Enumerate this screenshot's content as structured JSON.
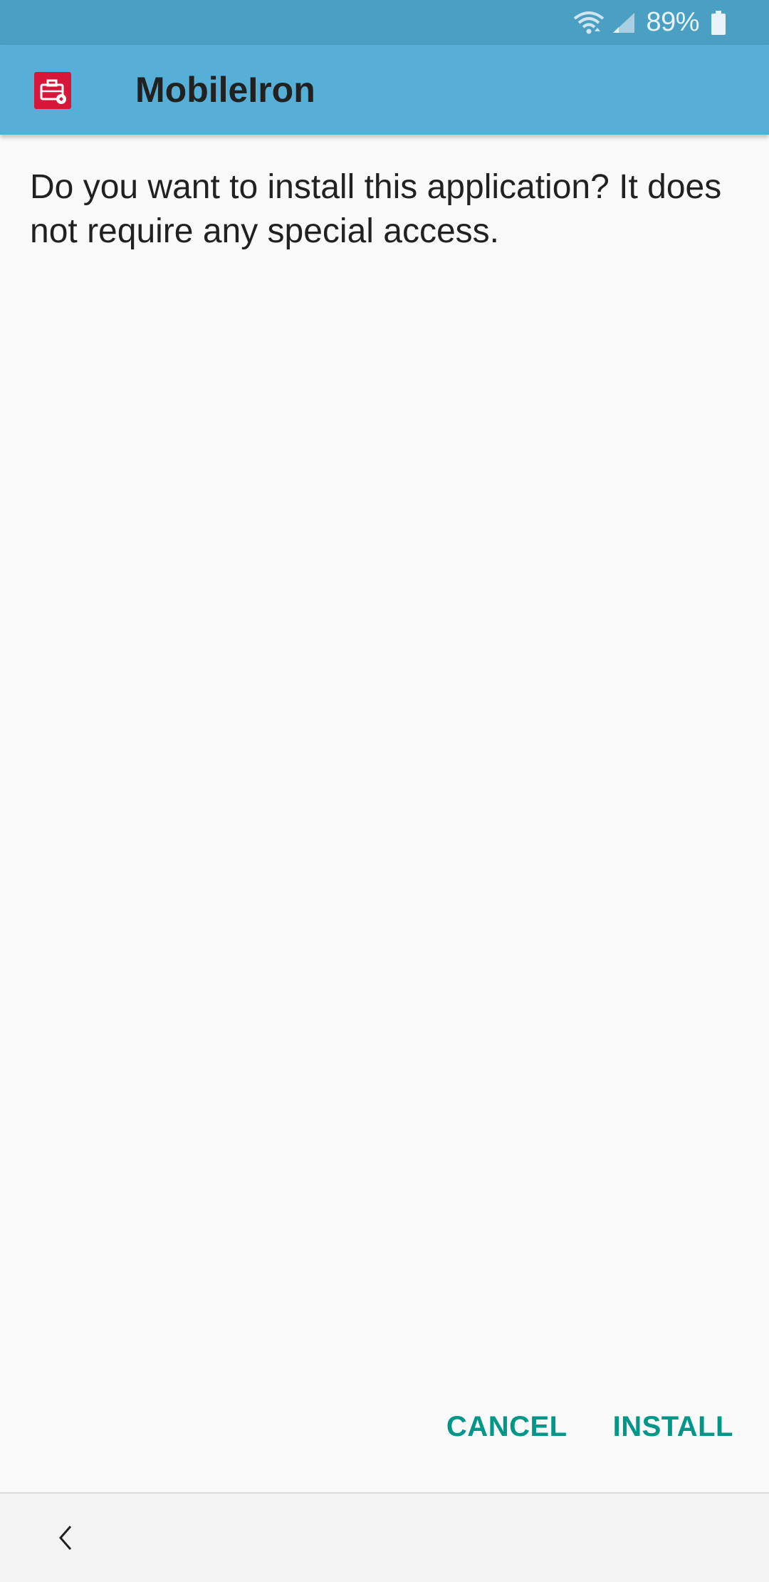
{
  "status_bar": {
    "battery_percent": "89%",
    "icons": [
      "wifi-icon",
      "cell-signal-icon",
      "battery-icon"
    ]
  },
  "app_bar": {
    "title": "MobileIron",
    "icon": "mobileiron-briefcase-icon",
    "accent_color": "#d6173a"
  },
  "dialog": {
    "message": "Do you want to install this application? It does not require any special access."
  },
  "actions": {
    "cancel_label": "CANCEL",
    "install_label": "INSTALL",
    "color": "#009688"
  },
  "nav_bar": {
    "back_icon": "back-chevron-icon"
  }
}
